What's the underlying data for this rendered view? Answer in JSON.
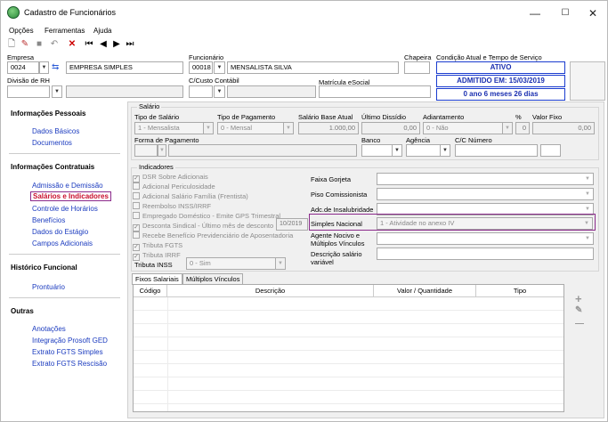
{
  "window": {
    "title": "Cadastro de Funcionários",
    "min": "—",
    "max": "☐",
    "close": "✕"
  },
  "menu": [
    {
      "label": "Opções"
    },
    {
      "label": "Ferramentas"
    },
    {
      "label": "Ajuda"
    }
  ],
  "header": {
    "empresa_label": "Empresa",
    "empresa_code": "0024",
    "empresa_name": "EMPRESA SIMPLES",
    "funcionario_label": "Funcionário",
    "funcionario_code": "00018",
    "funcionario_name": "MENSALISTA SILVA",
    "chapeira_label": "Chapeira",
    "condicao_label": "Condição Atual e Tempo de Serviço",
    "divisao_label": "Divisão de RH",
    "ccusto_label": "C/Custo Contábil",
    "matricula_label": "Matrícula eSocial",
    "status_ativo": "ATIVO",
    "status_admitido": "ADMITIDO EM: 15/03/2019",
    "status_tempo": "0 ano 6 meses 26 dias"
  },
  "sidebar": {
    "sections": [
      {
        "title": "Informações Pessoais",
        "items": [
          "Dados Básicos",
          "Documentos"
        ]
      },
      {
        "title": "Informações Contratuais",
        "items": [
          "Admissão e Demissão",
          "Salários e Indicadores",
          "Controle de Horários",
          "Benefícios",
          "Dados do Estágio",
          "Campos Adicionais"
        ]
      },
      {
        "title": "Histórico Funcional",
        "items": [
          "Prontuário"
        ]
      },
      {
        "title": "Outras",
        "items": [
          "Anotações",
          "Integração Prosoft GED",
          "Extrato FGTS Simples",
          "Extrato FGTS Rescisão"
        ]
      }
    ]
  },
  "salario": {
    "group": "Salário",
    "tipo_salario_label": "Tipo de Salário",
    "tipo_salario": "1 - Mensalista",
    "tipo_pagamento_label": "Tipo de Pagamento",
    "tipo_pagamento": "0 - Mensal",
    "base_label": "Salário Base Atual",
    "base": "1.000,00",
    "ultimo_label": "Último Dissídio",
    "ultimo": "0,00",
    "adiantamento_label": "Adiantamento",
    "adiantamento": "0 - Não",
    "pct_label": "%",
    "pct": "0",
    "fixo_label": "Valor Fixo",
    "fixo": "0,00",
    "forma_label": "Forma de Pagamento",
    "banco_label": "Banco",
    "agencia_label": "Agência",
    "cc_label": "C/C Número"
  },
  "indicadores": {
    "group": "Indicadores",
    "checks": [
      {
        "label": "DSR Sobre Adicionais",
        "checked": true
      },
      {
        "label": "Adicional Periculosidade",
        "checked": false
      },
      {
        "label": "Adicional Salário Família (Frentista)",
        "checked": false
      },
      {
        "label": "Reembolso INSS/IRRF",
        "checked": false
      },
      {
        "label": "Empregado Doméstico - Emite GPS Trimestral",
        "checked": false
      },
      {
        "label": "Desconta Sindical - Último mês de desconto",
        "checked": true
      },
      {
        "label": "Recebe Benefício Previdenciário de Aposentadoria",
        "checked": false
      },
      {
        "label": "Tributa FGTS",
        "checked": true
      },
      {
        "label": "Tributa IRRF",
        "checked": true
      }
    ],
    "sindical_mes": "10/2019",
    "inss_label": "Tributa INSS",
    "inss": "0 - Sim",
    "right": [
      {
        "label": "Faixa Gorjeta",
        "value": ""
      },
      {
        "label": "Piso Comissionista",
        "value": ""
      },
      {
        "label": "Adc.de Insalubridade",
        "value": ""
      },
      {
        "label": "Simples Nacional",
        "value": "1 - Atividade no anexo IV"
      },
      {
        "label": "Agente Nocivo e Múltiplos Vínculos",
        "value": ""
      },
      {
        "label": "Descrição salário variável",
        "value": ""
      }
    ]
  },
  "tabs": [
    {
      "label": "Fixos Salariais"
    },
    {
      "label": "Múltiplos Vínculos"
    }
  ],
  "grid": {
    "columns": [
      "Código",
      "Descrição",
      "Valor / Quantidade",
      "Tipo"
    ]
  },
  "grid_controls": {
    "add": "+",
    "edit": "✎",
    "remove": "—"
  }
}
